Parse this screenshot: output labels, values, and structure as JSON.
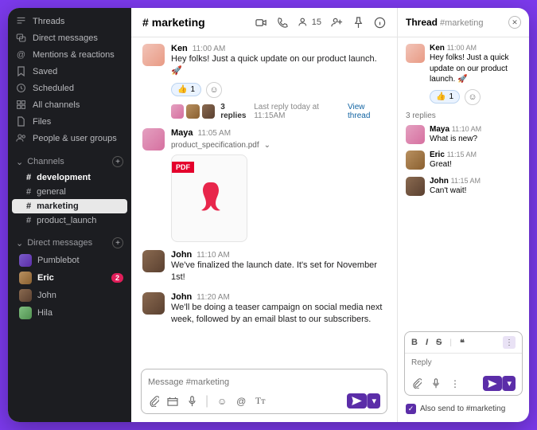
{
  "sidebar": {
    "top": [
      {
        "icon": "threads",
        "label": "Threads"
      },
      {
        "icon": "dm",
        "label": "Direct messages"
      },
      {
        "icon": "mentions",
        "label": "Mentions & reactions"
      },
      {
        "icon": "saved",
        "label": "Saved"
      },
      {
        "icon": "scheduled",
        "label": "Scheduled"
      },
      {
        "icon": "all-channels",
        "label": "All channels"
      },
      {
        "icon": "files",
        "label": "Files"
      },
      {
        "icon": "people",
        "label": "People & user groups"
      }
    ],
    "channels_label": "Channels",
    "channels": [
      {
        "name": "development",
        "bold": true
      },
      {
        "name": "general"
      },
      {
        "name": "marketing",
        "active": true
      },
      {
        "name": "product_launch"
      }
    ],
    "dm_label": "Direct messages",
    "dms": [
      {
        "name": "Pumblebot",
        "avatar": "pumble"
      },
      {
        "name": "Eric",
        "avatar": "eric",
        "bold": true,
        "badge": "2"
      },
      {
        "name": "John",
        "avatar": "john"
      },
      {
        "name": "Hila",
        "avatar": "hila"
      }
    ]
  },
  "header": {
    "hash": "#",
    "channel": "marketing",
    "members": "15"
  },
  "messages": [
    {
      "avatar": "ken",
      "name": "Ken",
      "time": "11:00 AM",
      "text": "Hey folks! Just a quick update on our product launch. 🚀",
      "react_emoji": "👍",
      "react_count": "1",
      "reply_count": "3 replies",
      "reply_meta": "Last reply today at 11:15AM",
      "reply_link": "View thread"
    },
    {
      "avatar": "maya",
      "name": "Maya",
      "time": "11:05 AM",
      "file": "product_specification.pdf",
      "pdf_label": "PDF"
    },
    {
      "avatar": "john",
      "name": "John",
      "time": "11:10 AM",
      "text": "We've finalized the launch date. It's set for November 1st!"
    },
    {
      "avatar": "john",
      "name": "John",
      "time": "11:20 AM",
      "text": "We'll be doing a teaser campaign on social media next week, followed by an email blast to our subscribers."
    }
  ],
  "composer": {
    "placeholder": "Message #marketing"
  },
  "thread": {
    "title": "Thread",
    "subtitle": "#marketing",
    "parent": {
      "avatar": "ken",
      "name": "Ken",
      "time": "11:00 AM",
      "text": "Hey folks! Just a quick update on our product launch. 🚀",
      "react_emoji": "👍",
      "react_count": "1"
    },
    "replies_label": "3 replies",
    "replies": [
      {
        "avatar": "maya",
        "name": "Maya",
        "time": "11:10 AM",
        "text": "What is new?"
      },
      {
        "avatar": "eric",
        "name": "Eric",
        "time": "11:15 AM",
        "text": "Great!"
      },
      {
        "avatar": "john",
        "name": "John",
        "time": "11:15 AM",
        "text": "Can't wait!"
      }
    ],
    "reply_placeholder": "Reply",
    "also_send": "Also send to #marketing"
  }
}
